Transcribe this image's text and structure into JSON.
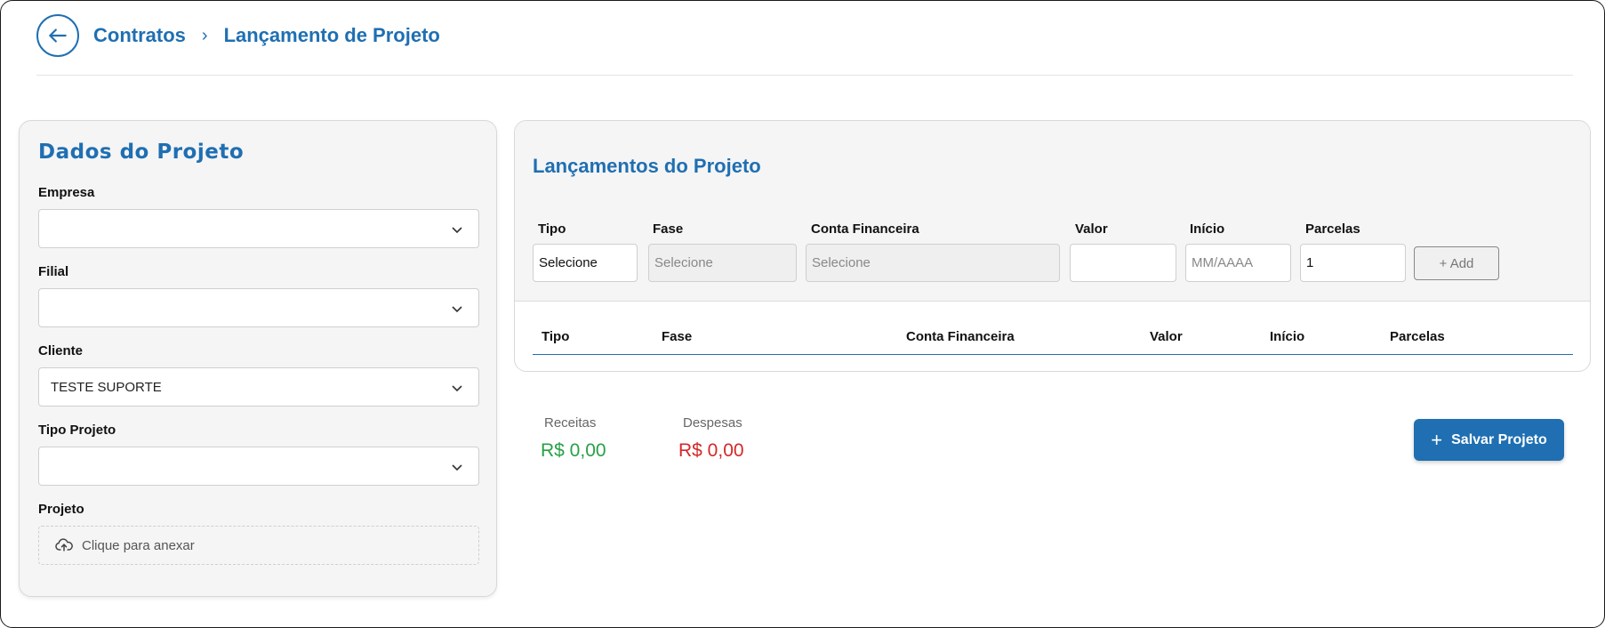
{
  "header": {
    "back_icon": "arrow-left-icon",
    "breadcrumb_root": "Contratos",
    "breadcrumb_separator": "›",
    "breadcrumb_current": "Lançamento de Projeto"
  },
  "left_panel": {
    "title": "Dados do Projeto",
    "fields": {
      "empresa": {
        "label": "Empresa",
        "value": ""
      },
      "filial": {
        "label": "Filial",
        "value": ""
      },
      "cliente": {
        "label": "Cliente",
        "value": "TESTE SUPORTE"
      },
      "tipo_projeto": {
        "label": "Tipo Projeto",
        "value": ""
      },
      "projeto": {
        "label": "Projeto",
        "upload_text": "Clique para anexar",
        "icon": "cloud-upload-icon"
      }
    }
  },
  "right_panel": {
    "title": "Lançamentos do Projeto",
    "entry": {
      "tipo": {
        "label": "Tipo",
        "value": "Selecione"
      },
      "fase": {
        "label": "Fase",
        "value": "Selecione"
      },
      "conta": {
        "label": "Conta Financeira",
        "value": "Selecione"
      },
      "valor": {
        "label": "Valor",
        "value": ""
      },
      "inicio": {
        "label": "Início",
        "placeholder": "MM/AAAA"
      },
      "parcelas": {
        "label": "Parcelas",
        "value": "1"
      },
      "add_label": "+ Add"
    },
    "table_headers": [
      "Tipo",
      "Fase",
      "Conta Financeira",
      "Valor",
      "Início",
      "Parcelas"
    ]
  },
  "totals": {
    "receitas_label": "Receitas",
    "receitas_value": "R$ 0,00",
    "despesas_label": "Despesas",
    "despesas_value": "R$ 0,00"
  },
  "save_button": {
    "icon": "plus-icon",
    "label": "Salvar Projeto"
  },
  "colors": {
    "primary": "#1f6fb2",
    "income": "#27a048",
    "expense": "#d42828"
  }
}
